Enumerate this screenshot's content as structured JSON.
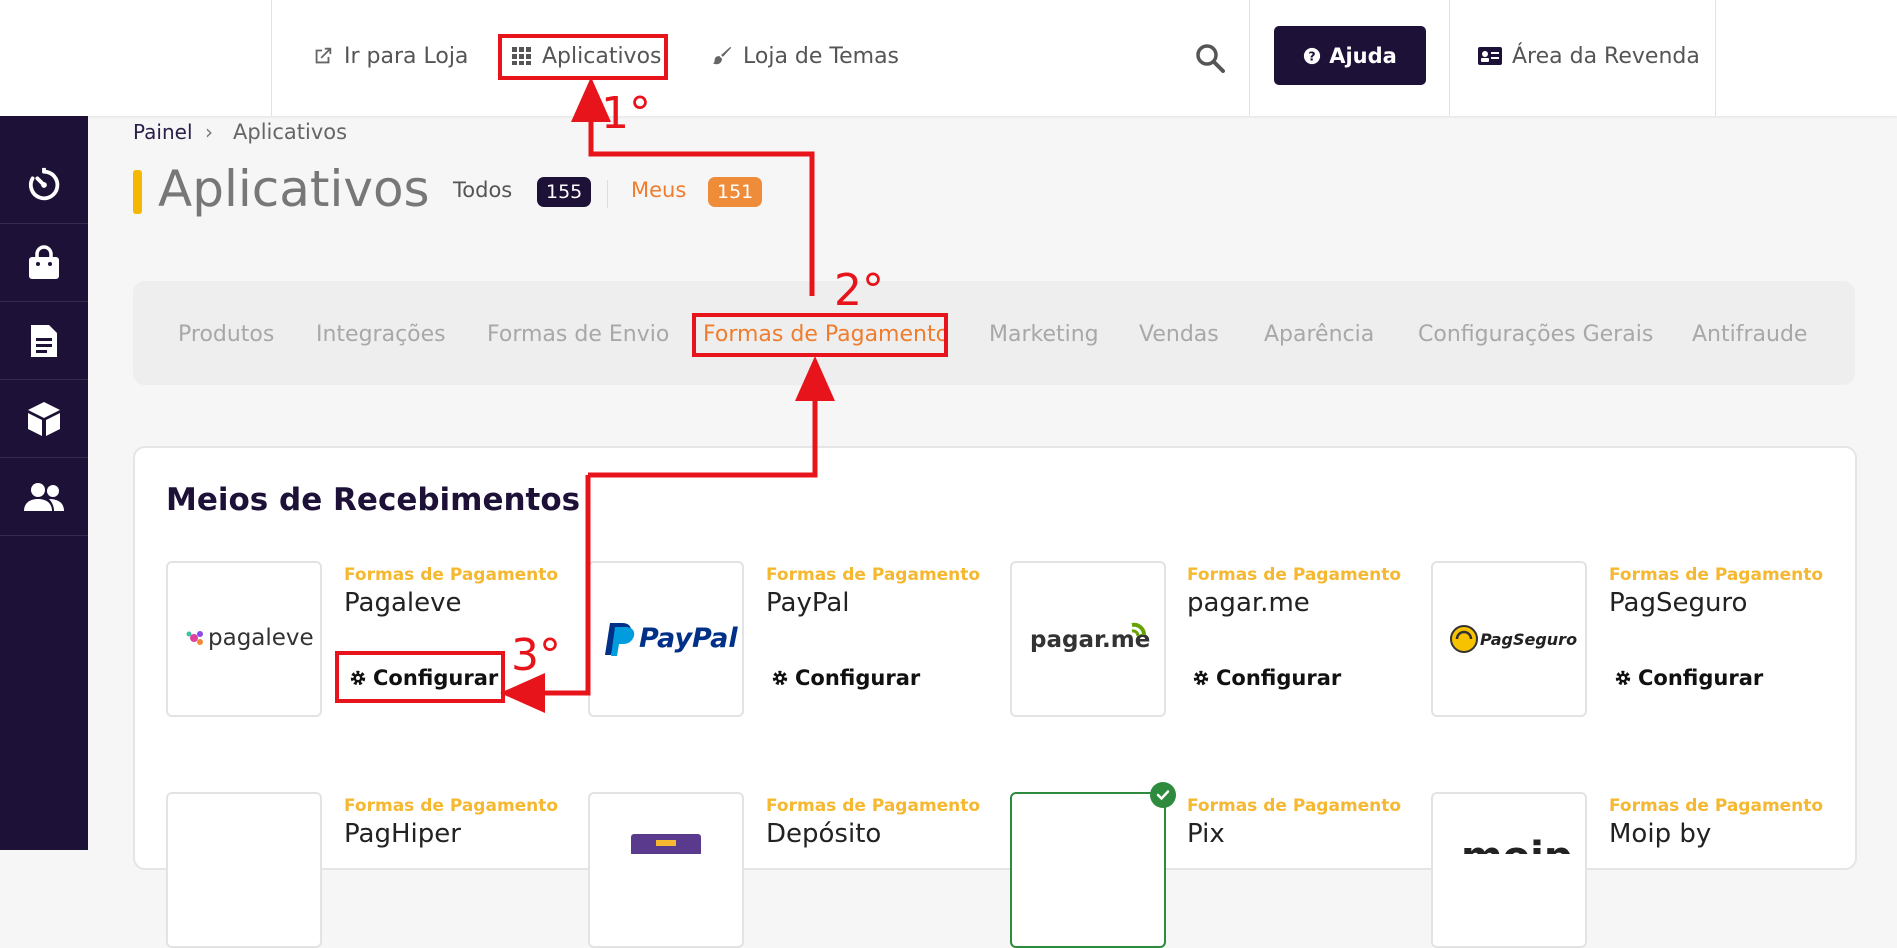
{
  "topbar": {
    "go_store": "Ir para Loja",
    "apps": "Aplicativos",
    "themes": "Loja de Temas",
    "help": "Ajuda",
    "reseller": "Área da Revenda"
  },
  "sidebar": {
    "icons": [
      "dashboard-icon",
      "shopping-bag-icon",
      "document-icon",
      "box-icon",
      "users-icon"
    ]
  },
  "breadcrumb": {
    "home": "Painel",
    "separator": "›",
    "current": "Aplicativos"
  },
  "page": {
    "title": "Aplicativos",
    "filters": [
      {
        "label": "Todos",
        "count": "155",
        "color": "#1e1138"
      },
      {
        "label": "Meus",
        "count": "151",
        "color": "#ef8c3a"
      }
    ]
  },
  "categories": {
    "tabs": [
      "Produtos",
      "Integrações",
      "Formas de Envio",
      "Formas de Pagamento",
      "Marketing",
      "Vendas",
      "Aparência",
      "Configurações Gerais",
      "Antifraude"
    ],
    "active": "Formas de Pagamento"
  },
  "section": {
    "title": "Meios de Recebimentos",
    "configure_label": "Configurar",
    "cards": [
      {
        "category": "Formas de Pagamento",
        "name": "Pagaleve",
        "logo_text": "pagaleve"
      },
      {
        "category": "Formas de Pagamento",
        "name": "PayPal",
        "logo_text": "PayPal"
      },
      {
        "category": "Formas de Pagamento",
        "name": "pagar.me",
        "logo_text": "pagar.me"
      },
      {
        "category": "Formas de Pagamento",
        "name": "PagSeguro",
        "logo_text": "PagSeguro"
      },
      {
        "category": "Formas de Pagamento",
        "name": "PagHiper"
      },
      {
        "category": "Formas de Pagamento",
        "name": "Depósito"
      },
      {
        "category": "Formas de Pagamento",
        "name": "Pix",
        "installed": true
      },
      {
        "category": "Formas de Pagamento",
        "name": "Moip by",
        "logo_text": "moip"
      }
    ]
  },
  "annotations": {
    "steps": [
      "1°",
      "2°",
      "3°"
    ],
    "color": "#e8141b"
  },
  "colors": {
    "sidebar": "#1e1138",
    "accent_orange": "#ef7d2d",
    "category_yellow": "#f5b830",
    "title_bar": "#f5b800"
  }
}
